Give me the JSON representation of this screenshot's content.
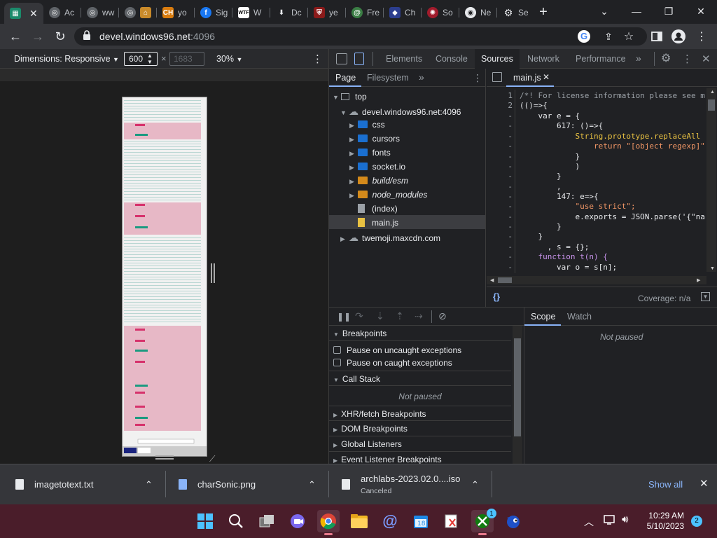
{
  "browser": {
    "tabs": [
      {
        "title": "",
        "favicon": "game-icon",
        "active": true
      },
      {
        "title": "Ac",
        "favicon": "globe-icon"
      },
      {
        "title": "ww",
        "favicon": "globe-icon"
      },
      {
        "title": "",
        "favicon": "globe-home-icon"
      },
      {
        "title": "yo",
        "favicon": "ch-icon"
      },
      {
        "title": "Sig",
        "favicon": "facebook-icon"
      },
      {
        "title": "W",
        "favicon": "wtf-icon"
      },
      {
        "title": "Dc",
        "favicon": "download-icon"
      },
      {
        "title": "ye",
        "favicon": "shield-icon"
      },
      {
        "title": "Fre",
        "favicon": "swirl-icon"
      },
      {
        "title": "Ch",
        "favicon": "ch-icon"
      },
      {
        "title": "So",
        "favicon": "gear-red-icon"
      },
      {
        "title": "Ne",
        "favicon": "chrome-icon"
      },
      {
        "title": "Se",
        "favicon": "settings-icon"
      }
    ],
    "url": {
      "host": "devel.windows96.net",
      "port": ":4096"
    }
  },
  "device_toolbar": {
    "dimensions_label": "Dimensions: Responsive",
    "width": "600",
    "height_placeholder": "1683",
    "times": "×",
    "zoom": "30%"
  },
  "devtools": {
    "tabs": [
      "Elements",
      "Console",
      "Sources",
      "Network",
      "Performance"
    ],
    "active_tab": "Sources",
    "navigator_tabs": [
      "Page",
      "Filesystem"
    ],
    "tree": [
      {
        "label": "top",
        "level": 0,
        "kind": "frame",
        "open": true
      },
      {
        "label": "devel.windows96.net:4096",
        "level": 1,
        "kind": "cloud",
        "open": true
      },
      {
        "label": "css",
        "level": 2,
        "kind": "folder"
      },
      {
        "label": "cursors",
        "level": 2,
        "kind": "folder"
      },
      {
        "label": "fonts",
        "level": 2,
        "kind": "folder"
      },
      {
        "label": "socket.io",
        "level": 2,
        "kind": "folder"
      },
      {
        "label": "build/esm",
        "level": 2,
        "kind": "folder-orange",
        "italic": true
      },
      {
        "label": "node_modules",
        "level": 2,
        "kind": "folder-orange",
        "italic": true
      },
      {
        "label": "(index)",
        "level": 2,
        "kind": "file"
      },
      {
        "label": "main.js",
        "level": 2,
        "kind": "file-js",
        "selected": true
      },
      {
        "label": "twemoji.maxcdn.com",
        "level": 1,
        "kind": "cloud",
        "open": false
      }
    ],
    "editor_tab": "main.js",
    "code_lines": [
      {
        "n": "1",
        "text": "/*! For license information please see m"
      },
      {
        "n": "2",
        "text": "(()=>{"
      },
      {
        "n": "-",
        "text": "    var e = {"
      },
      {
        "n": "-",
        "text": "        617: ()=>{"
      },
      {
        "n": "-",
        "text": "            String.prototype.replaceAll"
      },
      {
        "n": "-",
        "text": "                return \"[object regexp]\""
      },
      {
        "n": "-",
        "text": "            }"
      },
      {
        "n": "-",
        "text": "            )"
      },
      {
        "n": "-",
        "text": "        }"
      },
      {
        "n": "-",
        "text": "        ,"
      },
      {
        "n": "-",
        "text": "        147: e=>{"
      },
      {
        "n": "-",
        "text": "            \"use strict\";"
      },
      {
        "n": "-",
        "text": "            e.exports = JSON.parse('{\"na"
      },
      {
        "n": "-",
        "text": "        }"
      },
      {
        "n": "-",
        "text": "    }"
      },
      {
        "n": "-",
        "text": "      , s = {};"
      },
      {
        "n": "-",
        "text": "    function t(n) {"
      },
      {
        "n": "-",
        "text": "        var o = s[n];"
      }
    ],
    "coverage": "Coverage: n/a",
    "pretty_print": "{}",
    "breakpoints": {
      "section": "Breakpoints",
      "pause_uncaught": "Pause on uncaught exceptions",
      "pause_caught": "Pause on caught exceptions"
    },
    "call_stack": {
      "section": "Call Stack",
      "status": "Not paused"
    },
    "collapsed_sections": [
      "XHR/fetch Breakpoints",
      "DOM Breakpoints",
      "Global Listeners",
      "Event Listener Breakpoints"
    ],
    "scope_tabs": [
      "Scope",
      "Watch"
    ],
    "scope_status": "Not paused"
  },
  "downloads": {
    "items": [
      {
        "name": "imagetotext.txt",
        "status": ""
      },
      {
        "name": "charSonic.png",
        "status": ""
      },
      {
        "name": "archlabs-2023.02.0....iso",
        "status": "Canceled"
      }
    ],
    "show_all": "Show all"
  },
  "taskbar": {
    "time": "10:29 AM",
    "date": "5/10/2023",
    "notification_count": "2",
    "xbox_badge": "1"
  },
  "colors": {
    "accent": "#8ab4f8",
    "taskbar": "#4a1d2a",
    "selected_row": "#3c3d41"
  }
}
